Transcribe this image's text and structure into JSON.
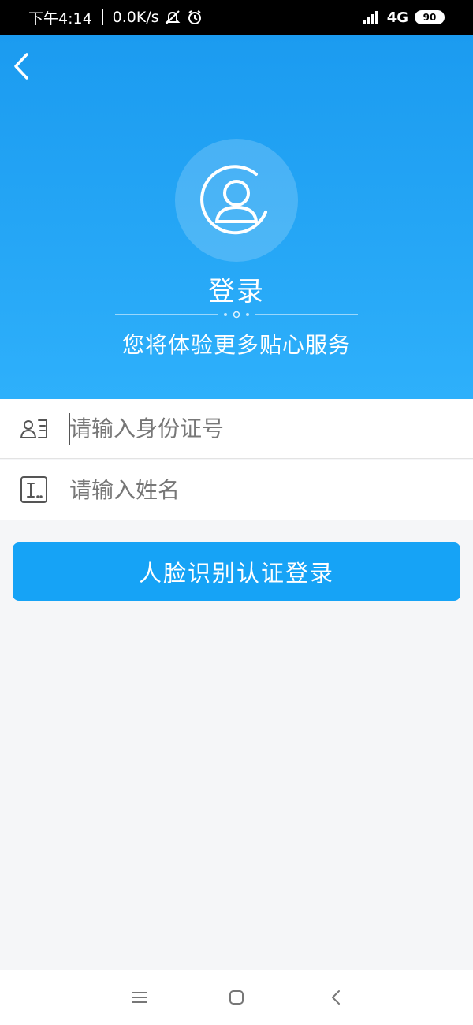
{
  "status_bar": {
    "time": "下午4:14",
    "speed": "0.0K/s",
    "network": "4G",
    "battery": "90"
  },
  "header": {
    "title": "登录",
    "subtitle": "您将体验更多贴心服务"
  },
  "form": {
    "id_placeholder": "请输入身份证号",
    "id_value": "",
    "name_placeholder": "请输入姓名",
    "name_value": ""
  },
  "login_button_label": "人脸识别认证登录",
  "colors": {
    "header_top": "#1b9bf0",
    "header_bottom": "#2eb0fb",
    "button": "#16a3f6",
    "background": "#f5f6f8"
  },
  "icons": {
    "back": "chevron-left-icon",
    "avatar": "user-avatar-icon",
    "id_card": "id-card-icon",
    "name": "text-field-icon",
    "nav_menu": "menu-icon",
    "nav_home": "home-square-icon",
    "nav_back": "back-triangle-icon"
  }
}
